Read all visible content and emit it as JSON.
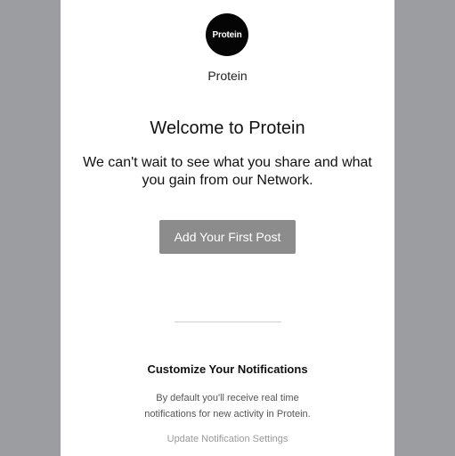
{
  "logo": {
    "text": "Protein",
    "background": "#050505",
    "text_color": "#ffffff"
  },
  "brand": {
    "name": "Protein"
  },
  "welcome": {
    "headline": "Welcome to Protein",
    "subhead": "We can't wait to see what you share and what you gain from our Network."
  },
  "cta": {
    "label": "Add Your First Post",
    "background": "#8c8c8c"
  },
  "notifications": {
    "title": "Customize Your Notifications",
    "body": "By default you'll receive real time notifications for new activity in Protein.",
    "link_label": "Update Notification Settings"
  },
  "colors": {
    "page_background": "#9c9da1",
    "card_background": "#ffffff"
  }
}
